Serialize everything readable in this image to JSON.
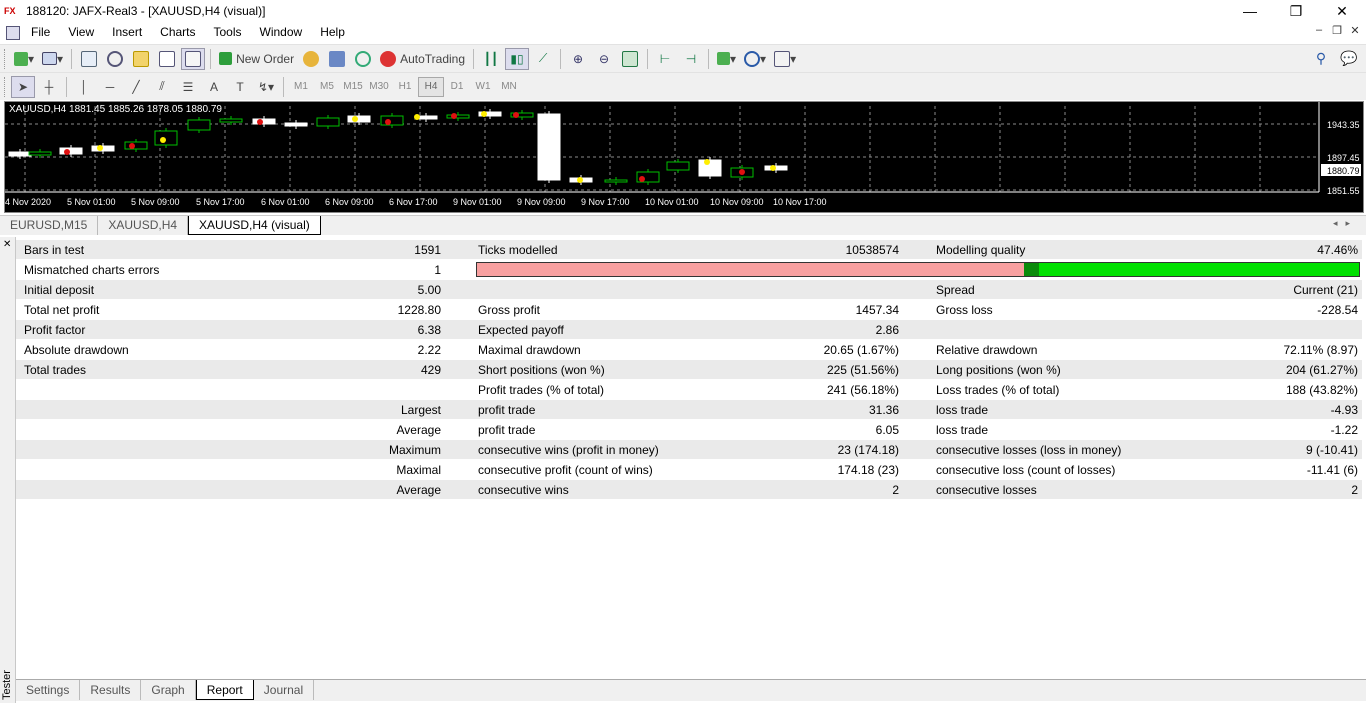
{
  "window": {
    "title": "188120: JAFX-Real3 - [XAUUSD,H4 (visual)]",
    "logo_text": "FX",
    "minimize": "—",
    "restore": "❐",
    "close": "✕"
  },
  "menu": [
    "File",
    "View",
    "Insert",
    "Charts",
    "Tools",
    "Window",
    "Help"
  ],
  "mdi": {
    "minimize": "–",
    "restore": "❐",
    "close": "✕"
  },
  "toolbar": {
    "new_order": "New Order",
    "autotrading": "AutoTrading"
  },
  "periods": [
    "M1",
    "M5",
    "M15",
    "M30",
    "H1",
    "H4",
    "D1",
    "W1",
    "MN"
  ],
  "active_period": "H4",
  "chart": {
    "info": "XAUUSD,H4  1881.45 1885.26 1878.05 1880.79",
    "price_labels": [
      "1943.35",
      "1897.45",
      "1880.79",
      "1851.55"
    ],
    "current_price": "1880.79",
    "time_labels": [
      "4 Nov 2020",
      "5 Nov 01:00",
      "5 Nov 09:00",
      "5 Nov 17:00",
      "6 Nov 01:00",
      "6 Nov 09:00",
      "6 Nov 17:00",
      "9 Nov 01:00",
      "9 Nov 09:00",
      "9 Nov 17:00",
      "10 Nov 01:00",
      "10 Nov 09:00",
      "10 Nov 17:00"
    ]
  },
  "chart_tabs": [
    "EURUSD,M15",
    "XAUUSD,H4",
    "XAUUSD,H4 (visual)"
  ],
  "active_chart_tab": "XAUUSD,H4 (visual)",
  "tester": {
    "label": "Tester",
    "close": "✕"
  },
  "report": {
    "rows": [
      {
        "l1": "Bars in test",
        "v1": "1591",
        "l2": "Ticks modelled",
        "v2": "10538574",
        "l3": "Modelling quality",
        "v3": "47.46%"
      },
      {
        "l1": "Mismatched charts errors",
        "v1": "1",
        "bar": true
      },
      {
        "l1": "Initial deposit",
        "v1": "5.00",
        "l3": "Spread",
        "v3": "Current (21)"
      },
      {
        "l1": "Total net profit",
        "v1": "1228.80",
        "l2": "Gross profit",
        "v2": "1457.34",
        "l3": "Gross loss",
        "v3": "-228.54"
      },
      {
        "l1": "Profit factor",
        "v1": "6.38",
        "l2": "Expected payoff",
        "v2": "2.86"
      },
      {
        "l1": "Absolute drawdown",
        "v1": "2.22",
        "l2": "Maximal drawdown",
        "v2": "20.65 (1.67%)",
        "l3": "Relative drawdown",
        "v3": "72.11% (8.97)"
      },
      {
        "l1": "Total trades",
        "v1": "429",
        "l2": "Short positions (won %)",
        "v2": "225 (51.56%)",
        "l3": "Long positions (won %)",
        "v3": "204 (61.27%)"
      },
      {
        "l2": "Profit trades (% of total)",
        "v2": "241 (56.18%)",
        "l3": "Loss trades (% of total)",
        "v3": "188 (43.82%)"
      },
      {
        "v1": "Largest",
        "l2": "profit trade",
        "v2": "31.36",
        "l3": "loss trade",
        "v3": "-4.93"
      },
      {
        "v1": "Average",
        "l2": "profit trade",
        "v2": "6.05",
        "l3": "loss trade",
        "v3": "-1.22"
      },
      {
        "v1": "Maximum",
        "l2": "consecutive wins (profit in money)",
        "v2": "23 (174.18)",
        "l3": "consecutive losses (loss in money)",
        "v3": "9 (-10.41)"
      },
      {
        "v1": "Maximal",
        "l2": "consecutive profit (count of wins)",
        "v2": "174.18 (23)",
        "l3": "consecutive loss (count of losses)",
        "v3": "-11.41 (6)"
      },
      {
        "v1": "Average",
        "l2": "consecutive wins",
        "v2": "2",
        "l3": "consecutive losses",
        "v3": "2"
      }
    ],
    "modelling_quality_fraction": 0.4746
  },
  "bottom_tabs": [
    "Settings",
    "Results",
    "Graph",
    "Report",
    "Journal"
  ],
  "active_bottom_tab": "Report",
  "colors": {
    "chart_bg": "#000000",
    "bull_candle": "#00c000",
    "bear_candle": "#ffffff",
    "quality_bad": "#f8a0a0",
    "quality_good": "#00e000"
  }
}
